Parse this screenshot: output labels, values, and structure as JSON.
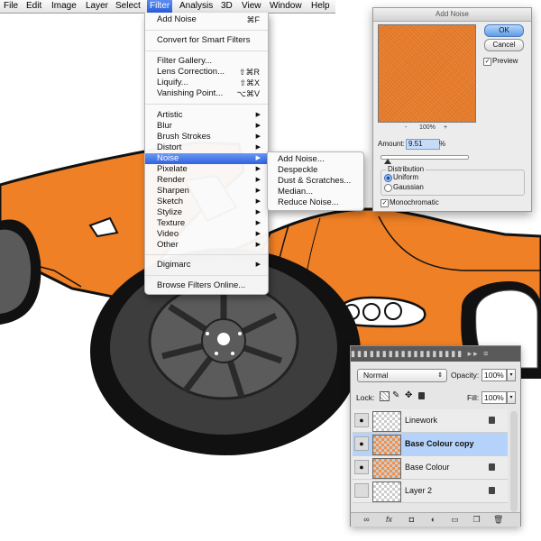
{
  "menubar": {
    "items": [
      "File",
      "Edit",
      "Image",
      "Layer",
      "Select",
      "Filter",
      "Analysis",
      "3D",
      "View",
      "Window",
      "Help"
    ],
    "active": "Filter"
  },
  "filter_menu": {
    "add_noise": {
      "label": "Add Noise",
      "shortcut": "⌘F"
    },
    "convert": "Convert for Smart Filters",
    "filter_gallery": "Filter Gallery...",
    "lens_correction": {
      "label": "Lens Correction...",
      "shortcut": "⇧⌘R"
    },
    "liquify": {
      "label": "Liquify...",
      "shortcut": "⇧⌘X"
    },
    "vanishing_point": {
      "label": "Vanishing Point...",
      "shortcut": "⌥⌘V"
    },
    "submenus": [
      "Artistic",
      "Blur",
      "Brush Strokes",
      "Distort",
      "Noise",
      "Pixelate",
      "Render",
      "Sharpen",
      "Sketch",
      "Stylize",
      "Texture",
      "Video",
      "Other"
    ],
    "highlighted": "Noise",
    "digimarc": "Digimarc",
    "browse_online": "Browse Filters Online..."
  },
  "noise_submenu": {
    "items": [
      "Add Noise...",
      "Despeckle",
      "Dust & Scratches...",
      "Median...",
      "Reduce Noise..."
    ]
  },
  "add_noise_dialog": {
    "title": "Add Noise",
    "ok_label": "OK",
    "cancel_label": "Cancel",
    "preview_label": "Preview",
    "preview_checked": true,
    "zoom_minus": "-",
    "zoom_level": "100%",
    "zoom_plus": "+",
    "amount_label": "Amount:",
    "amount_value": "9.51",
    "amount_unit": "%",
    "distribution_label": "Distribution",
    "uniform_label": "Uniform",
    "gaussian_label": "Gaussian",
    "distribution_selected": "Uniform",
    "monochromatic_label": "Monochromatic",
    "monochromatic_checked": true,
    "preview_color": "#ef7f2a"
  },
  "layers_panel": {
    "blend_mode": "Normal",
    "opacity_label": "Opacity:",
    "opacity_value": "100%",
    "lock_label": "Lock:",
    "fill_label": "Fill:",
    "fill_value": "100%",
    "layers": [
      {
        "name": "Linework",
        "visible": true,
        "locked": true,
        "selected": false
      },
      {
        "name": "Base Colour copy",
        "visible": true,
        "locked": false,
        "selected": true
      },
      {
        "name": "Base Colour",
        "visible": true,
        "locked": true,
        "selected": false
      },
      {
        "name": "Layer 2",
        "visible": false,
        "locked": true,
        "selected": false
      }
    ],
    "selection_color": "#b5d3fa"
  },
  "artwork": {
    "body_color": "#f08025",
    "outline_color": "#111111",
    "wheel_color": "#3d3d3d"
  }
}
